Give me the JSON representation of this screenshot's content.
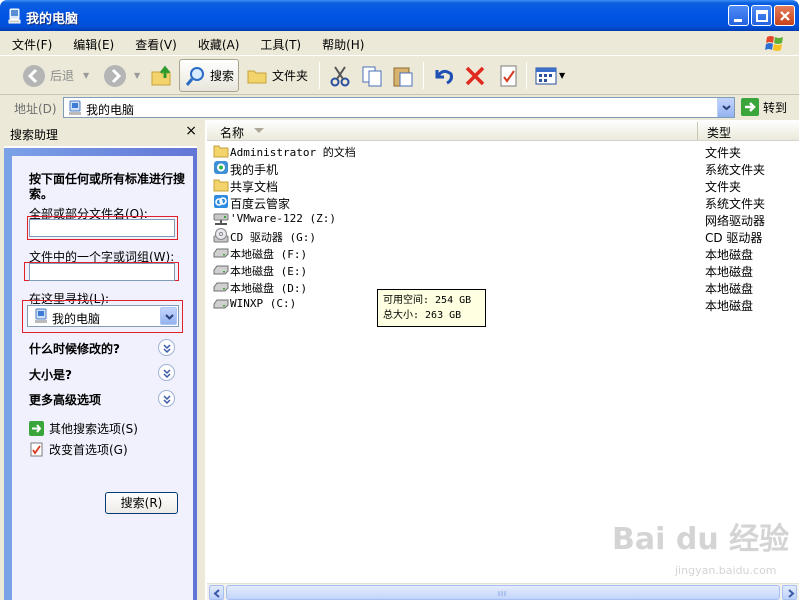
{
  "window": {
    "title": "我的电脑"
  },
  "menu": [
    "文件(F)",
    "编辑(E)",
    "查看(V)",
    "收藏(A)",
    "工具(T)",
    "帮助(H)"
  ],
  "toolbar": {
    "back": "后退",
    "search": "搜索",
    "folders": "文件夹"
  },
  "address": {
    "label": "地址(D)",
    "value": "我的电脑",
    "go": "转到"
  },
  "search_pane": {
    "title": "搜索助理",
    "close": "×",
    "intro": "按下面任何或所有标准进行搜索。",
    "name_label": "全部或部分文件名(O):",
    "name_value": "",
    "word_label": "文件中的一个字或词组(W):",
    "word_value": "",
    "look_in_label": "在这里寻找(L):",
    "look_in_value": "我的电脑",
    "sections": [
      "什么时候修改的?",
      "大小是?",
      "更多高级选项"
    ],
    "links": [
      "其他搜索选项(S)",
      "改变首选项(G)"
    ],
    "search_button": "搜索(R)"
  },
  "columns": {
    "name": "名称",
    "type": "类型"
  },
  "items": [
    {
      "name": "Administrator 的文档",
      "type": "文件夹",
      "icon": "folder-icon"
    },
    {
      "name": "我的手机",
      "type": "系统文件夹",
      "icon": "phone-icon"
    },
    {
      "name": "共享文档",
      "type": "文件夹",
      "icon": "folder-icon"
    },
    {
      "name": "百度云管家",
      "type": "系统文件夹",
      "icon": "cloud-icon"
    },
    {
      "name": "'VMware-122 (Z:)",
      "type": "网络驱动器",
      "icon": "network-drive-icon"
    },
    {
      "name": "CD 驱动器 (G:)",
      "type": "CD 驱动器",
      "icon": "cd-drive-icon"
    },
    {
      "name": "本地磁盘 (F:)",
      "type": "本地磁盘",
      "icon": "disk-icon"
    },
    {
      "name": "本地磁盘 (E:)",
      "type": "本地磁盘",
      "icon": "disk-icon"
    },
    {
      "name": "本地磁盘 (D:)",
      "type": "本地磁盘",
      "icon": "disk-icon"
    },
    {
      "name": "WINXP (C:)",
      "type": "本地磁盘",
      "icon": "disk-icon"
    }
  ],
  "tooltip": {
    "free": "可用空间: 254 GB",
    "total": "总大小: 263 GB"
  },
  "watermark": {
    "brand": "Bai du 经验",
    "url": "jingyan.baidu.com"
  },
  "colors": {
    "title_blue": "#0054e3",
    "pane_blue": "#6375d6",
    "highlight_red": "#e0202a"
  }
}
